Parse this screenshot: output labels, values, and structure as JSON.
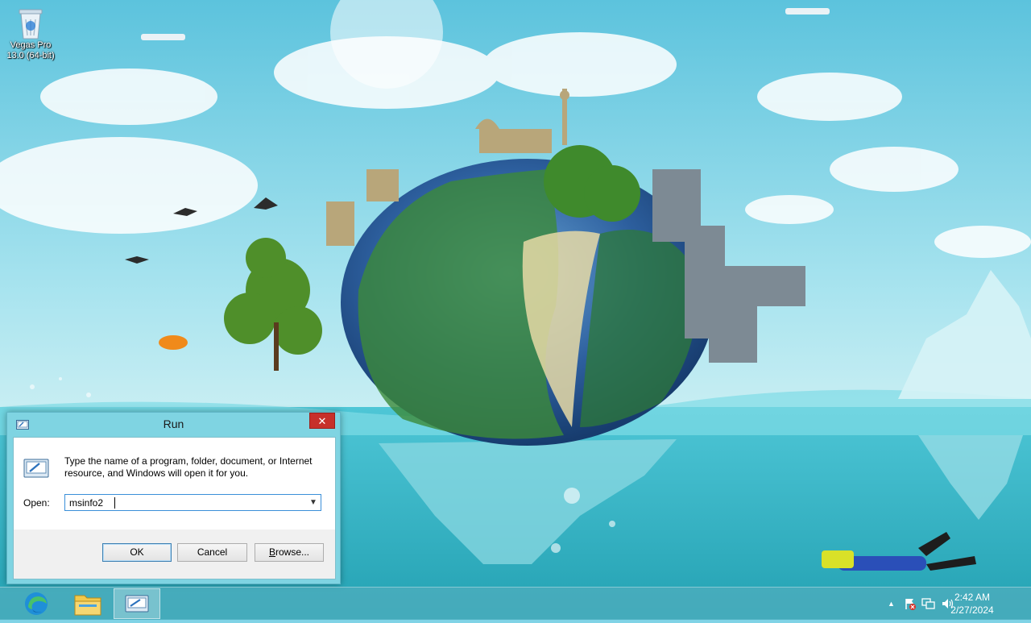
{
  "desktop": {
    "icons": [
      {
        "label_line1": "Vegas Pro",
        "label_line2": "13.0 (64-bit)"
      }
    ]
  },
  "run_dialog": {
    "title": "Run",
    "close_label": "✕",
    "description": "Type the name of a program, folder, document, or Internet resource, and Windows will open it for you.",
    "open_label": "Open:",
    "open_value": "msinfo2",
    "ok_label": "OK",
    "cancel_label": "Cancel",
    "browse_label": "Browse..."
  },
  "taskbar": {
    "apps": [
      "edge-icon",
      "file-explorer-icon",
      "run-icon"
    ],
    "tray": {
      "overflow_glyph": "▲",
      "time": "2:42 AM",
      "date": "2/27/2024"
    }
  },
  "colors": {
    "taskbar": "#46aab9",
    "close_button": "#c7302a",
    "dialog_frame": "#7fd4e2"
  }
}
